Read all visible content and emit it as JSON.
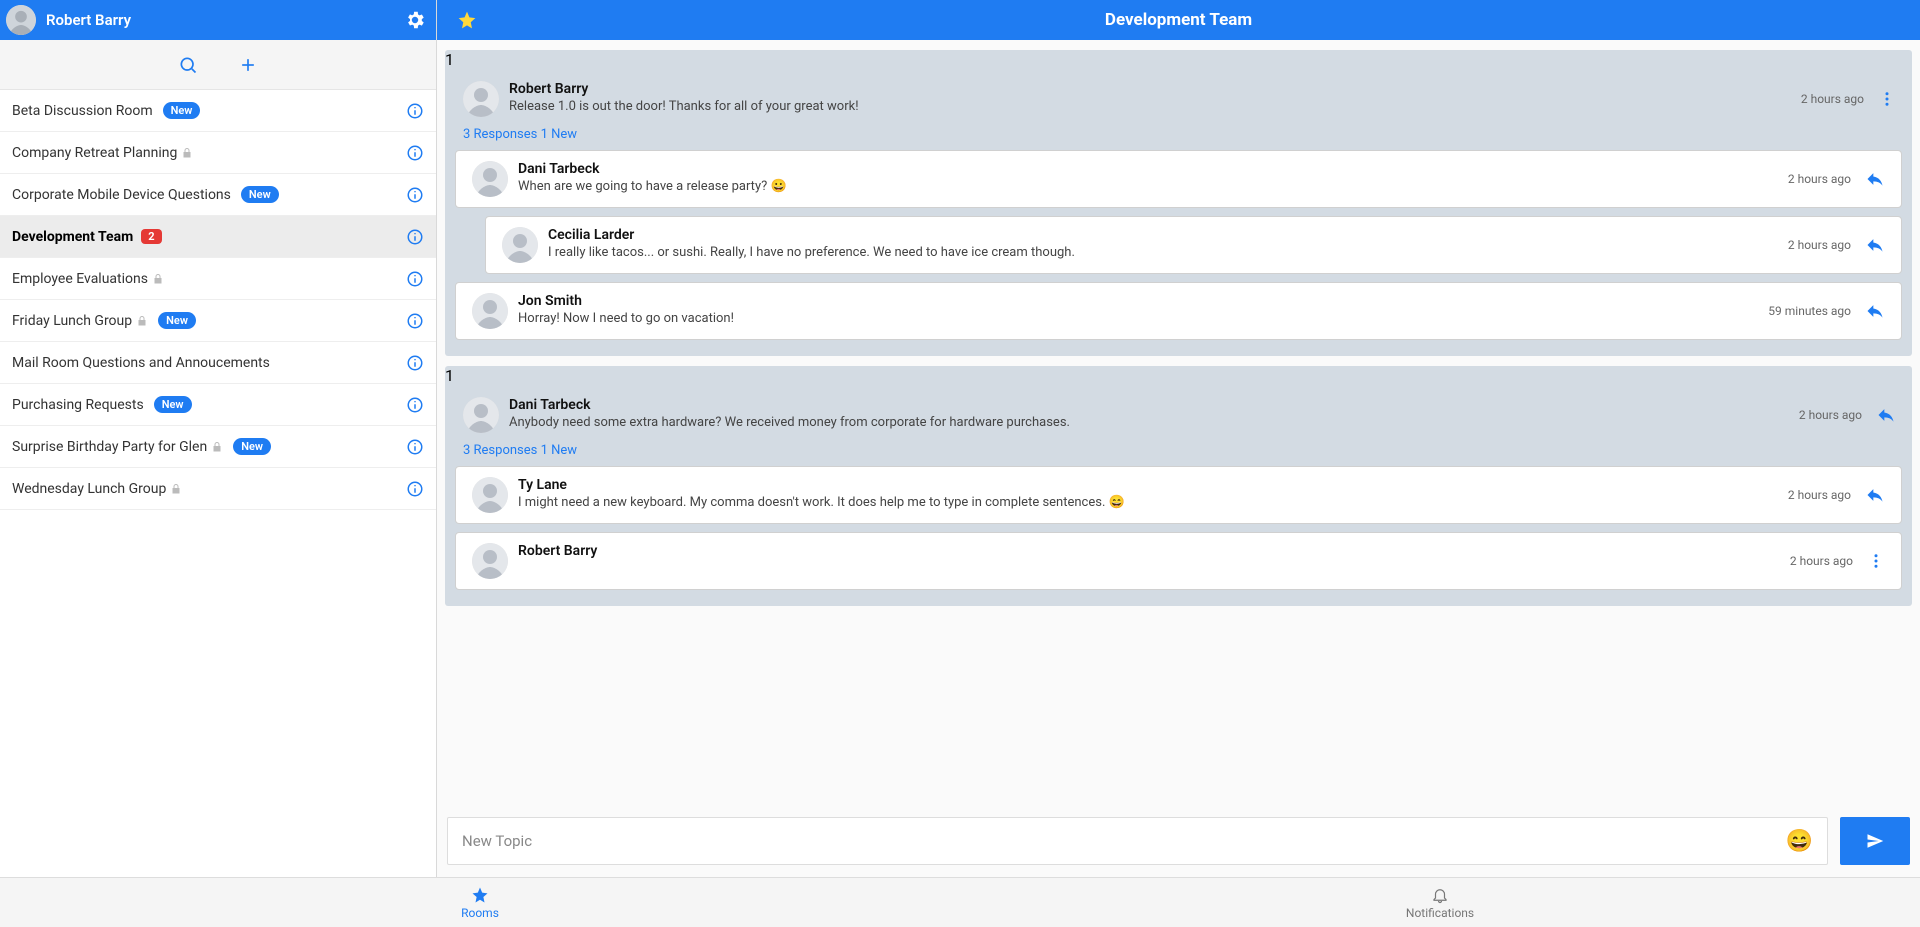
{
  "user": {
    "name": "Robert Barry"
  },
  "sidebar": {
    "rooms": [
      {
        "name": "Beta Discussion Room",
        "new": true,
        "locked": false,
        "count": null,
        "active": false
      },
      {
        "name": "Company Retreat Planning",
        "new": false,
        "locked": true,
        "count": null,
        "active": false
      },
      {
        "name": "Corporate Mobile Device Questions",
        "new": true,
        "locked": false,
        "count": null,
        "active": false
      },
      {
        "name": "Development Team",
        "new": false,
        "locked": false,
        "count": "2",
        "active": true
      },
      {
        "name": "Employee Evaluations",
        "new": false,
        "locked": true,
        "count": null,
        "active": false
      },
      {
        "name": "Friday Lunch Group",
        "new": true,
        "locked": true,
        "count": null,
        "active": false
      },
      {
        "name": "Mail Room Questions and Annoucements",
        "new": false,
        "locked": false,
        "count": null,
        "active": false
      },
      {
        "name": "Purchasing Requests",
        "new": true,
        "locked": false,
        "count": null,
        "active": false
      },
      {
        "name": "Surprise Birthday Party for Glen",
        "new": true,
        "locked": true,
        "count": null,
        "active": false
      },
      {
        "name": "Wednesday Lunch Group",
        "new": false,
        "locked": true,
        "count": null,
        "active": false
      }
    ],
    "new_label": "New"
  },
  "main": {
    "title": "Development Team",
    "topics": [
      {
        "badge": "1",
        "author": "Robert Barry",
        "text": "Release 1.0 is out the door! Thanks for all of your great work!",
        "time": "2 hours ago",
        "responses_line": "3 Responses 1 New",
        "show_more": true,
        "replies": [
          {
            "author": "Dani Tarbeck",
            "text": "When are we going to have a release party? 😀",
            "time": "2 hours ago",
            "indent": false,
            "unread": false
          },
          {
            "author": "Cecilia Larder",
            "text": "I really like tacos... or sushi. Really, I have no preference. We need to have ice cream though.",
            "time": "2 hours ago",
            "indent": true,
            "unread": false
          },
          {
            "author": "Jon Smith",
            "text": "Horray! Now I need to go on vacation!",
            "time": "59 minutes ago",
            "indent": false,
            "unread": true
          }
        ]
      },
      {
        "badge": "1",
        "author": "Dani Tarbeck",
        "text": "Anybody need some extra hardware? We received money from corporate for hardware purchases.",
        "time": "2 hours ago",
        "responses_line": "3 Responses 1 New",
        "show_more": false,
        "replies": [
          {
            "author": "Ty Lane",
            "text": "I might need a new keyboard. My comma doesn't work. It does help me to type in complete sentences. 😄",
            "time": "2 hours ago",
            "indent": false,
            "unread": false
          },
          {
            "author": "Robert Barry",
            "text": "",
            "time": "2 hours ago",
            "indent": false,
            "unread": false,
            "show_more": true
          }
        ]
      }
    ],
    "compose_placeholder": "New Topic"
  },
  "bottom_nav": {
    "rooms": "Rooms",
    "notifications": "Notifications"
  }
}
